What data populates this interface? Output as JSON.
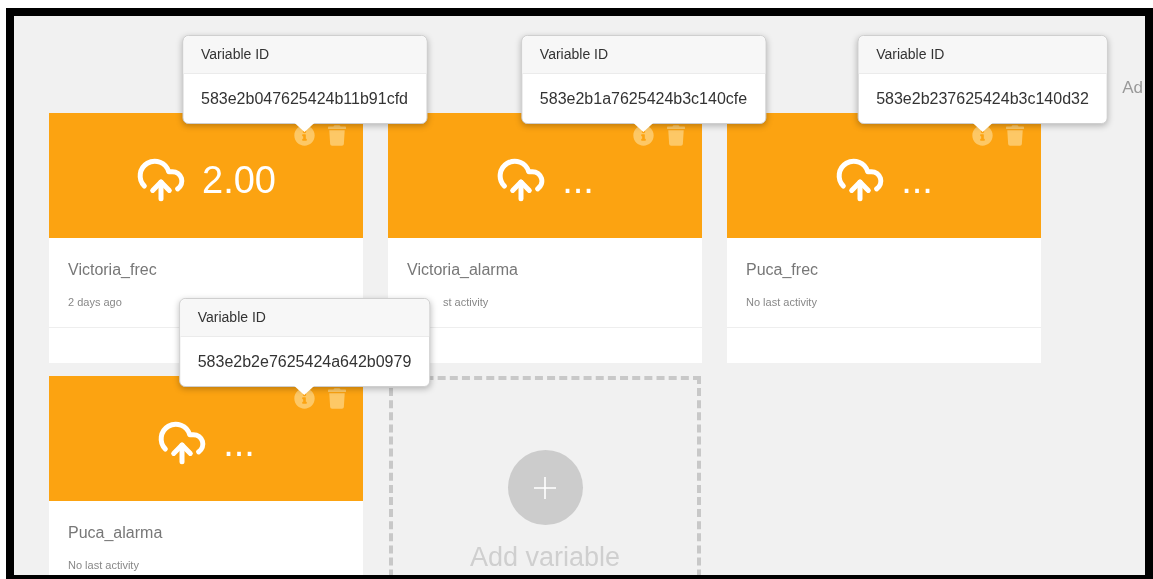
{
  "top_right_link": "Ad",
  "cards": [
    {
      "value": "2.00",
      "name": "Victoria_frec",
      "activity": "2 days ago",
      "partly_covered": false,
      "tooltip": {
        "title": "Variable ID",
        "id": "583e2b047625424b11b91cfd"
      }
    },
    {
      "value": "...",
      "name": "Victoria_alarma",
      "activity": "st activity",
      "partly_covered": true,
      "tooltip": {
        "title": "Variable ID",
        "id": "583e2b1a7625424b3c140cfe"
      }
    },
    {
      "value": "...",
      "name": "Puca_frec",
      "activity": "No last activity",
      "partly_covered": false,
      "tooltip": {
        "title": "Variable ID",
        "id": "583e2b237625424b3c140d32"
      }
    },
    {
      "value": "...",
      "name": "Puca_alarma",
      "activity": "No last activity",
      "partly_covered": false,
      "tooltip": {
        "title": "Variable ID",
        "id": "583e2b2e7625424a642b0979"
      }
    }
  ],
  "add_card": {
    "label": "Add variable"
  }
}
